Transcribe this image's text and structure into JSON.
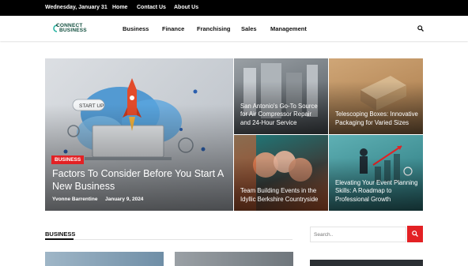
{
  "topbar": {
    "date": "Wednesday, January 31",
    "links": [
      "Home",
      "Contact Us",
      "About Us"
    ]
  },
  "logo": {
    "line1": "CONNECT",
    "line2": "BUSINESS"
  },
  "nav": {
    "items": [
      "Business",
      "Finance",
      "Franchising",
      "Sales",
      "Management"
    ]
  },
  "icons": {
    "search": "search-icon",
    "logo": "connect-mark-icon"
  },
  "hero": {
    "main": {
      "category": "BUSINESS",
      "title": "Factors To Consider Before You Start A New Business",
      "author": "Yvonne Barrentine",
      "date": "January 9, 2024"
    },
    "cards": [
      {
        "title": "San Antonio's Go-To Source for Air Compressor Repair and 24-Hour Service"
      },
      {
        "title": "Telescoping Boxes: Innovative Packaging for Varied Sizes"
      },
      {
        "title": "Team Building Events in the Idyllic Berkshire Countryside"
      },
      {
        "title": "Elevating Your Event Planning Skills: A Roadmap to Professional Growth"
      }
    ]
  },
  "section": {
    "title": "BUSINESS"
  },
  "sidebar": {
    "search_placeholder": "Search.."
  },
  "colors": {
    "accent": "#e32124",
    "topbar": "#000000",
    "brand": "#124f3f"
  }
}
